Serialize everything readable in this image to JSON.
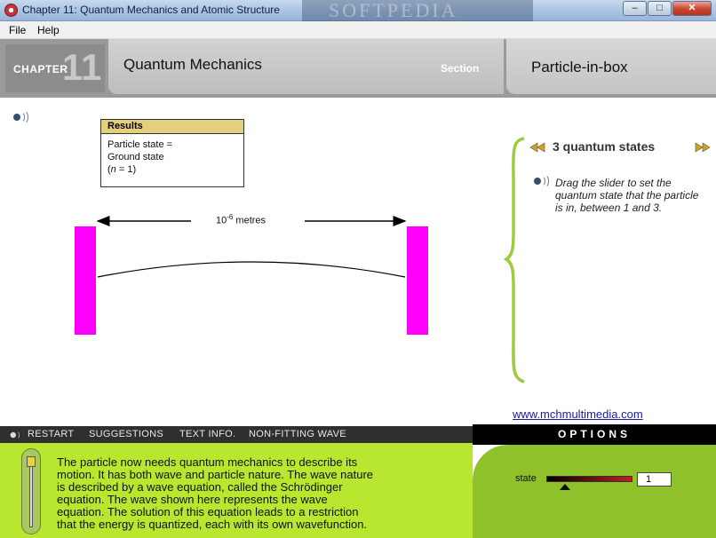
{
  "window": {
    "title": "Chapter 11:  Quantum Mechanics and Atomic Structure",
    "watermark": "SOFTPEDIA",
    "min": "–",
    "max": "□",
    "close": "✕"
  },
  "menu": {
    "file": "File",
    "help": "Help"
  },
  "header": {
    "chapter_label": "CHAPTER",
    "chapter_number": "11",
    "topic": "Quantum Mechanics",
    "section_label": "Section",
    "subtopic": "Particle-in-box"
  },
  "results": {
    "heading": "Results",
    "line1": "Particle state =",
    "line2": "Ground state",
    "line3_prefix": "(",
    "line3_var": "n",
    "line3_rest": " = 1)"
  },
  "box": {
    "length_base": "10",
    "length_exp": "-6",
    "length_unit": " metres",
    "wall_color": "#ff00ff"
  },
  "panel": {
    "states_title": "3 quantum states",
    "hint": "Drag the slider to set the quantum state that the particle is in, between 1 and 3.",
    "link": "www.mchmultimedia.com",
    "brace_color": "#9acd3c"
  },
  "toolbar": {
    "restart": "RESTART",
    "suggestions": "SUGGESTIONS",
    "text_info": "TEXT INFO.",
    "non_fitting": "NON-FITTING WAVE"
  },
  "options": {
    "heading": "OPTIONS",
    "state_label": "state",
    "state_value": "1",
    "slider_min": 1,
    "slider_max": 3,
    "slider_value": 1
  },
  "body_text": "The particle now needs quantum mechanics to describe its motion.  It has both wave and particle nature.  The wave nature is described by a wave equation, called the Schrödinger equation. The wave shown here represents the wave equation.  The solution of this equation leads to a restriction that the energy is quantized, each with its own wavefunction."
}
